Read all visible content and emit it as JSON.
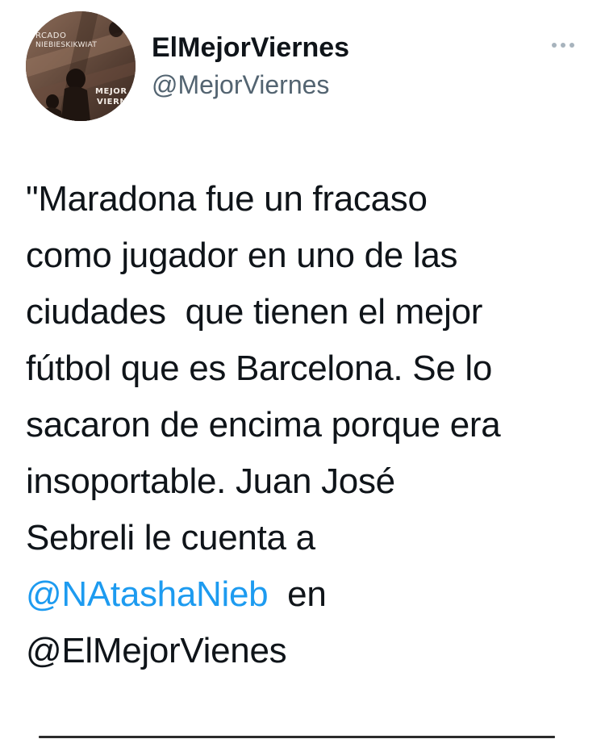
{
  "user": {
    "display_name": "ElMejorViernes",
    "handle": "@MejorViernes"
  },
  "avatar": {
    "line1": "RCADO",
    "line2": "NIEBIESKIKWIAT",
    "line3": "MEJOR",
    "line4": "VIERN"
  },
  "more_icon": "more-horizontal-icon",
  "tweet": {
    "lines": [
      "\"Maradona fue un fracaso",
      "como jugador en uno de las",
      "ciudades  que tienen el mejor",
      "fútbol que es Barcelona. Se lo",
      "sacaron de encima porque era",
      "insoportable. Juan José",
      "Sebreli le cuenta a"
    ],
    "mention": "@NAtashaNieb",
    "after_mention": "  en",
    "last_line": "@ElMejorVienes"
  },
  "colors": {
    "link": "#1d9bf0",
    "text": "#0f1419",
    "secondary": "#536471"
  }
}
